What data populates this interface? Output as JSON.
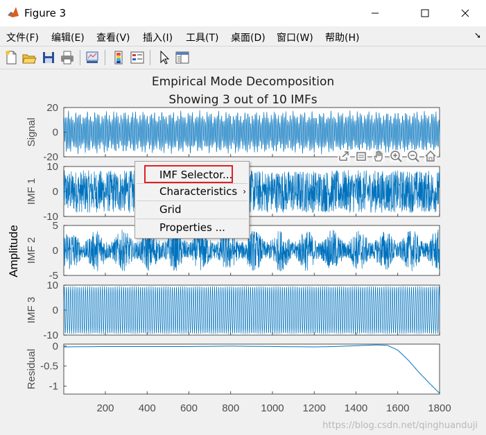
{
  "window": {
    "title": "Figure 3"
  },
  "menu": [
    {
      "label": "文件(F)"
    },
    {
      "label": "编辑(E)"
    },
    {
      "label": "查看(V)"
    },
    {
      "label": "插入(I)"
    },
    {
      "label": "工具(T)"
    },
    {
      "label": "桌面(D)"
    },
    {
      "label": "窗口(W)"
    },
    {
      "label": "帮助(H)"
    }
  ],
  "toolbar_icons": [
    "new-figure-icon",
    "open-file-icon",
    "save-icon",
    "print-icon",
    "link-plot-icon",
    "insert-colorbar-icon",
    "insert-legend-icon",
    "edit-plot-arrow-icon",
    "property-inspector-icon"
  ],
  "axes_toolbar_icons": [
    "export-icon",
    "brush-icon",
    "pan-hand-icon",
    "zoom-in-icon",
    "zoom-out-icon",
    "home-icon"
  ],
  "plot": {
    "title": "Empirical Mode Decomposition",
    "subtitle": "Showing 3 out of 10 IMFs",
    "ylabel": "Amplitude",
    "line_color": "#0072bd"
  },
  "chart_data": [
    {
      "type": "line",
      "ylabel": "Signal",
      "yticks": [
        "20",
        "0",
        "-20"
      ],
      "ylim": [
        -20,
        20
      ],
      "xlim": [
        1,
        1800
      ],
      "description_values": {
        "amplitude_range": [
          -18,
          18
        ]
      }
    },
    {
      "type": "line",
      "ylabel": "IMF 1",
      "yticks": [
        "10",
        "0",
        "-10"
      ],
      "ylim": [
        -10,
        10
      ],
      "xlim": [
        1,
        1800
      ]
    },
    {
      "type": "line",
      "ylabel": "IMF 2",
      "yticks": [
        "5",
        "0",
        "-5"
      ],
      "ylim": [
        -5,
        5
      ],
      "xlim": [
        1,
        1800
      ]
    },
    {
      "type": "line",
      "ylabel": "IMF 3",
      "yticks": [
        "10",
        "0",
        "-10"
      ],
      "ylim": [
        -10,
        10
      ],
      "xlim": [
        1,
        1800
      ]
    },
    {
      "type": "line",
      "ylabel": "Residual",
      "yticks": [
        "0",
        "-0.5",
        "-1"
      ],
      "ylim": [
        -1.2,
        0.05
      ],
      "xlim": [
        1,
        1800
      ],
      "x": [
        1,
        200,
        400,
        600,
        800,
        1000,
        1200,
        1300,
        1400,
        1450,
        1500,
        1550,
        1600,
        1650,
        1700,
        1750,
        1800
      ],
      "y": [
        -0.02,
        -0.01,
        -0.01,
        -0.01,
        0.0,
        -0.01,
        -0.02,
        -0.01,
        0.01,
        0.02,
        0.03,
        0.02,
        -0.1,
        -0.35,
        -0.65,
        -0.92,
        -1.18
      ]
    }
  ],
  "xticks": [
    "200",
    "400",
    "600",
    "800",
    "1000",
    "1200",
    "1400",
    "1600",
    "1800"
  ],
  "xtick_values": [
    200,
    400,
    600,
    800,
    1000,
    1200,
    1400,
    1600,
    1800
  ],
  "context_menu": {
    "items": [
      {
        "label": "IMF Selector..."
      },
      {
        "label": "Characteristics"
      },
      {
        "label": "Grid"
      },
      {
        "label": "Properties ..."
      }
    ],
    "submenu_arrow": "›"
  },
  "watermark": "https://blog.csdn.net/qinghuanduji"
}
